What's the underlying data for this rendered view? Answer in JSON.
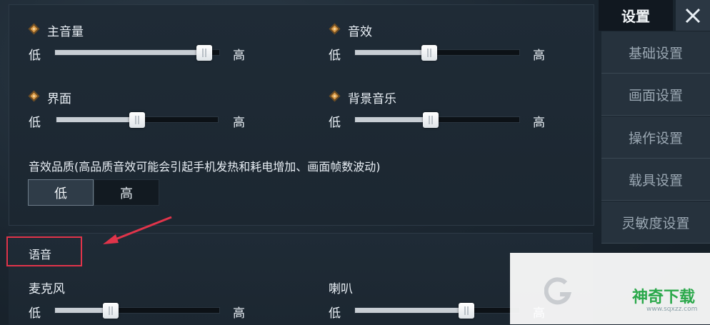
{
  "sliders": [
    {
      "id": "master",
      "label": "主音量",
      "low": "低",
      "high": "高",
      "value": 0.91,
      "icon": "diamond-icon"
    },
    {
      "id": "sfx",
      "label": "音效",
      "low": "低",
      "high": "高",
      "value": 0.45,
      "icon": "diamond-icon"
    },
    {
      "id": "ui",
      "label": "界面",
      "low": "低",
      "high": "高",
      "value": 0.5,
      "icon": "diamond-icon"
    },
    {
      "id": "bgm",
      "label": "背景音乐",
      "low": "低",
      "high": "高",
      "value": 0.46,
      "icon": "diamond-icon"
    },
    {
      "id": "mic",
      "label": "麦克风",
      "low": "低",
      "high": "高",
      "value": 0.34
    },
    {
      "id": "speaker",
      "label": "喇叭",
      "low": "低",
      "high": "高",
      "value": 0.68
    }
  ],
  "quality": {
    "label": "音效品质(高品质音效可能会引起手机发热和耗电增加、画面帧数波动)",
    "options": [
      "低",
      "高"
    ],
    "selected": "低"
  },
  "voice_section": {
    "label": "语音"
  },
  "sidebar": {
    "title": "设置",
    "items": [
      {
        "label": "基础设置"
      },
      {
        "label": "画面设置"
      },
      {
        "label": "操作设置"
      },
      {
        "label": "载具设置"
      },
      {
        "label": "灵敏度设置"
      }
    ]
  },
  "watermark": {
    "brand": "神奇下载",
    "url": "www.sqxzz.com"
  },
  "colors": {
    "accent_diamond": "#d89a47",
    "highlight_box": "#e0344a",
    "watermark_green": "#2aa84a"
  }
}
